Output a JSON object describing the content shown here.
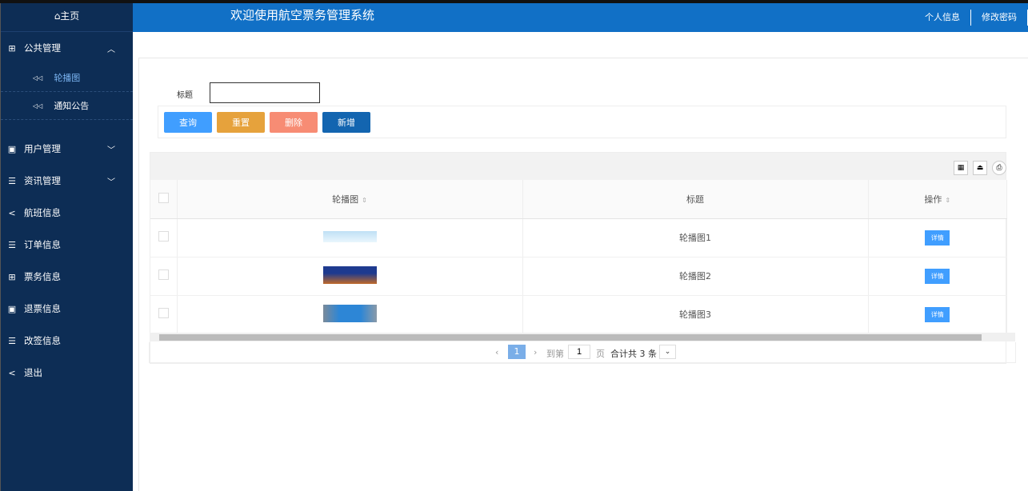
{
  "sidebar": {
    "home": "⌂主页",
    "menus": [
      {
        "label": "公共管理",
        "icon": "⊞",
        "open": true,
        "subs": [
          {
            "label": "轮播图",
            "active": true
          },
          {
            "label": "通知公告"
          }
        ]
      },
      {
        "label": "用户管理",
        "icon": "▣"
      },
      {
        "label": "资讯管理",
        "icon": "☰"
      },
      {
        "label": "航班信息",
        "icon": "<"
      },
      {
        "label": "订单信息",
        "icon": "☰"
      },
      {
        "label": "票务信息",
        "icon": "⊞"
      },
      {
        "label": "退票信息",
        "icon": "▣"
      },
      {
        "label": "改签信息",
        "icon": "☰"
      },
      {
        "label": "退出",
        "icon": "<"
      }
    ]
  },
  "header": {
    "title": "欢迎使用航空票务管理系统",
    "links": [
      "个人信息",
      "修改密码"
    ]
  },
  "search": {
    "label": "标题",
    "value": ""
  },
  "buttons": {
    "query": "查询",
    "reset": "重置",
    "delete": "删除",
    "add": "新增"
  },
  "colors": {
    "query": "#409eff",
    "reset": "#e6a23c",
    "delete": "#f78c74",
    "add": "#1365b0"
  },
  "table": {
    "headers": [
      "轮播图",
      "标题",
      "操作"
    ],
    "rows": [
      {
        "title": "轮播图1",
        "action": "详情"
      },
      {
        "title": "轮播图2",
        "action": "详情"
      },
      {
        "title": "轮播图3",
        "action": "详情"
      }
    ]
  },
  "pager": {
    "prev": "‹",
    "page": "1",
    "next": "›",
    "goto": "到第",
    "input": "1",
    "page_unit": "页",
    "total": "合计共 3 条"
  }
}
